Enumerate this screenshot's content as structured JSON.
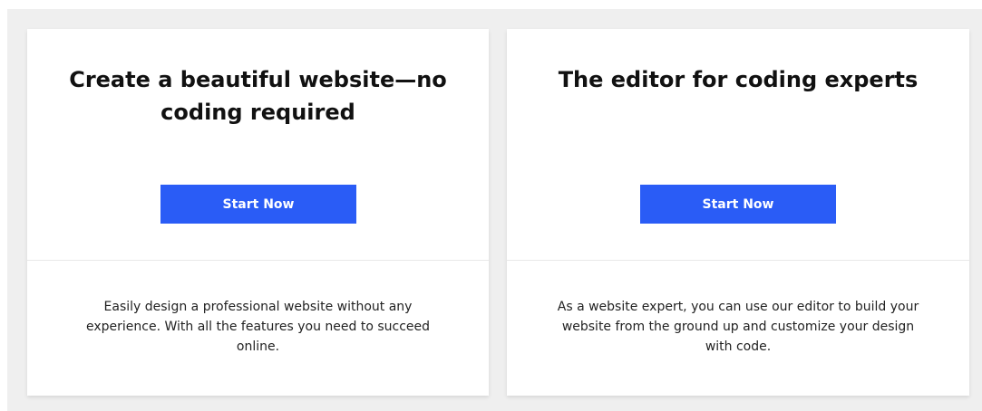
{
  "cards": [
    {
      "title": "Create a beautiful website—no coding required",
      "button_label": "Start Now",
      "description": "Easily design a professional website without any experience. With all the features you need to succeed online."
    },
    {
      "title": "The editor for coding experts",
      "button_label": "Start Now",
      "description": "As a website expert, you can use our editor to build your website from the ground up and customize your design with code."
    }
  ],
  "colors": {
    "button": "#2a5cf6",
    "panel_background": "#efefef",
    "card_background": "#ffffff"
  }
}
